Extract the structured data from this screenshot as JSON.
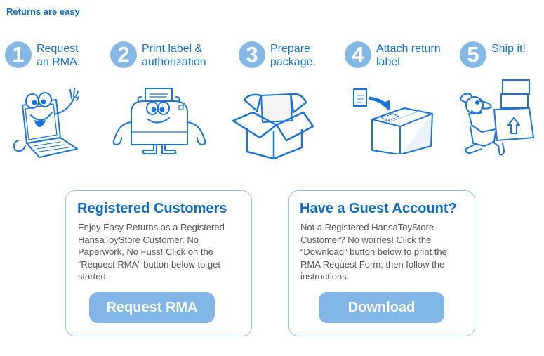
{
  "page": {
    "title": "Returns are easy"
  },
  "steps": [
    {
      "number": "1",
      "label": "Request\nan RMA.",
      "illustration": "laptop-mascot"
    },
    {
      "number": "2",
      "label": "Print label &\nauthorization",
      "illustration": "printer-mascot"
    },
    {
      "number": "3",
      "label": "Prepare\npackage.",
      "illustration": "open-box"
    },
    {
      "number": "4",
      "label": "Attach return\nlabel",
      "illustration": "label-on-box"
    },
    {
      "number": "5",
      "label": "Ship it!",
      "illustration": "delivery-man"
    }
  ],
  "registered": {
    "title": "Registered Customers",
    "text": "Enjoy Easy Returns as a Registered HansaToyStore Customer.  No Paperwork, No Fuss!  Click on the “Request RMA” button below to get started.",
    "button_label": "Request RMA"
  },
  "guest": {
    "title": "Have a Guest Account?",
    "text": "Not a Registered HansaToyStore Customer?  No worries!  Click the “Download” button below to print the RMA Request Form, then follow the instructions.",
    "button_label": "Download"
  },
  "colors": {
    "accent": "#0d6bc8",
    "step_circle": "#86b8e6",
    "button": "#81b6e7",
    "border": "#93c3ea",
    "body_text": "#555555"
  }
}
